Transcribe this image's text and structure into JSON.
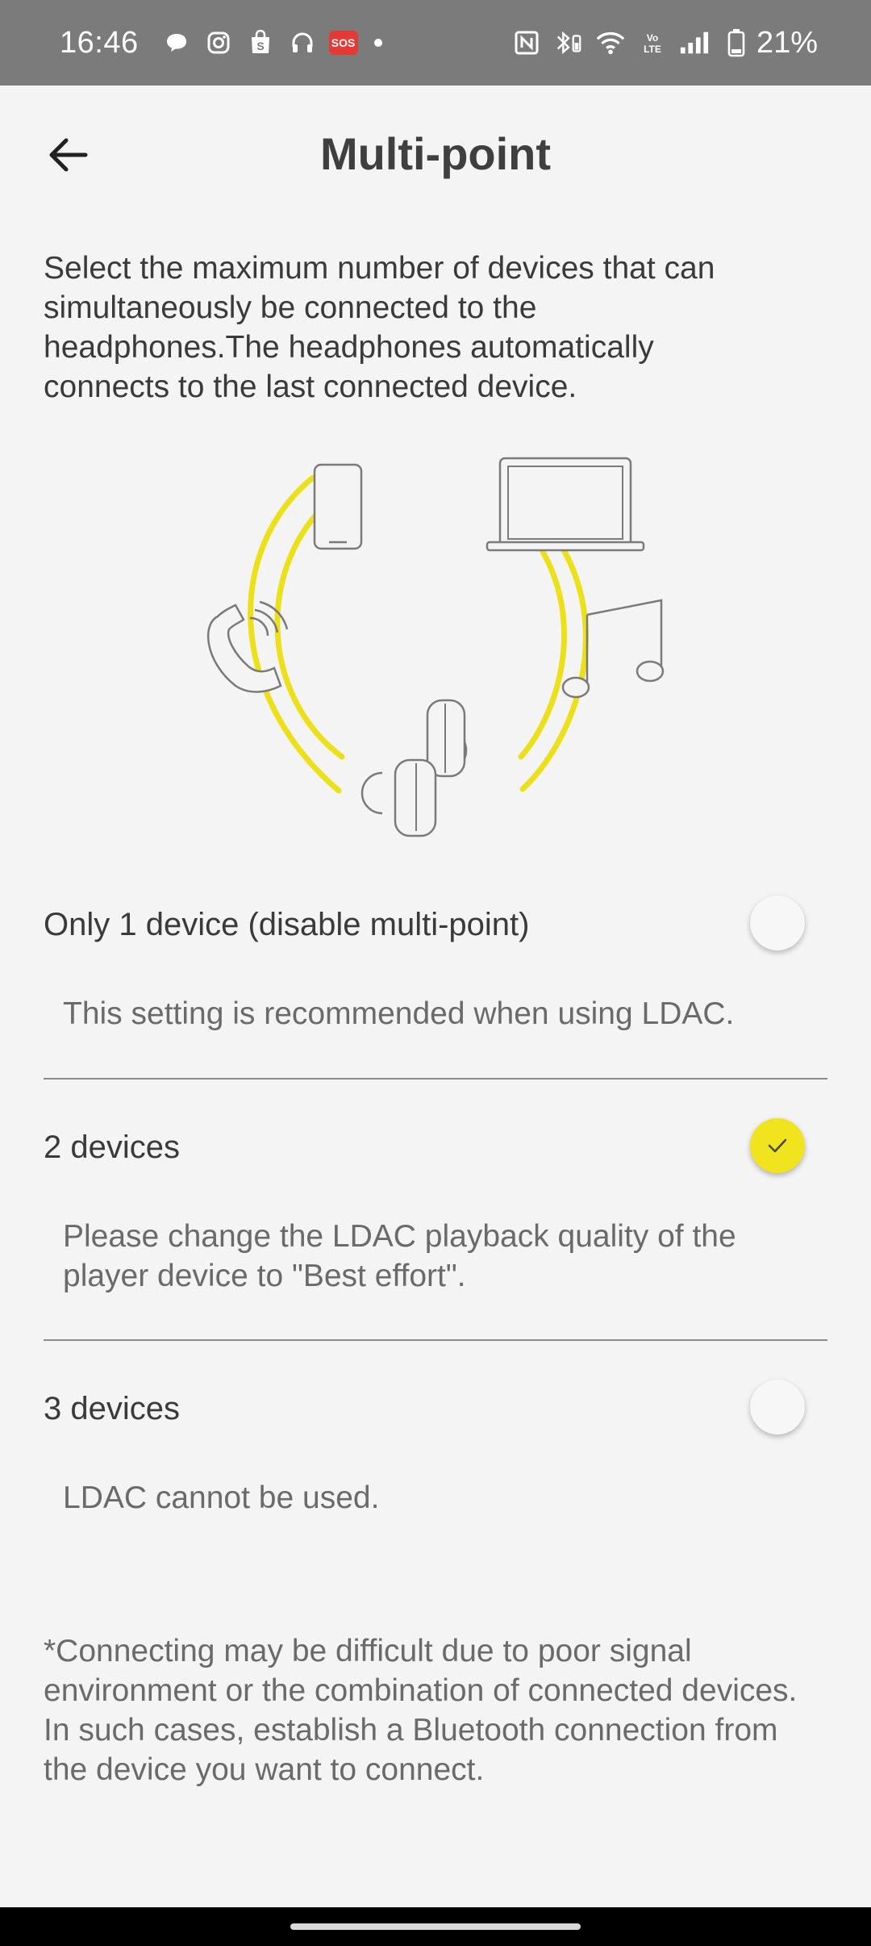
{
  "status_bar": {
    "time": "16:46",
    "icons": [
      "chat-bubble-icon",
      "instagram-icon",
      "shopping-bag-icon",
      "headphones-icon",
      "sos-icon",
      "dot-icon"
    ],
    "sos_label": "SOS",
    "right_icons": [
      "nfc-icon",
      "bluetooth-battery-icon",
      "wifi-icon",
      "volte-icon",
      "signal-icon",
      "battery-icon"
    ],
    "battery_percent": "21%"
  },
  "header": {
    "back_icon": "arrow-left-icon",
    "title": "Multi-point"
  },
  "description": "Select the maximum number of devices that can simultaneously be connected to the headphones.The headphones automatically connects to the last connected device.",
  "options": [
    {
      "label": "Only 1 device (disable multi-point)",
      "note": "This setting is recommended when using LDAC.",
      "selected": false
    },
    {
      "label": "2 devices",
      "note": "Please change the LDAC playback quality of the player device to \"Best effort\".",
      "selected": true
    },
    {
      "label": "3 devices",
      "note": "LDAC cannot be used.",
      "selected": false
    }
  ],
  "footnote": "*Connecting may be difficult due to poor signal environment or the combination of connected devices. In such cases, establish a Bluetooth connection from the device you want to connect.",
  "colors": {
    "accent": "#f1e31d",
    "status_bar": "#7b7b7b",
    "background": "#f4f4f4"
  }
}
